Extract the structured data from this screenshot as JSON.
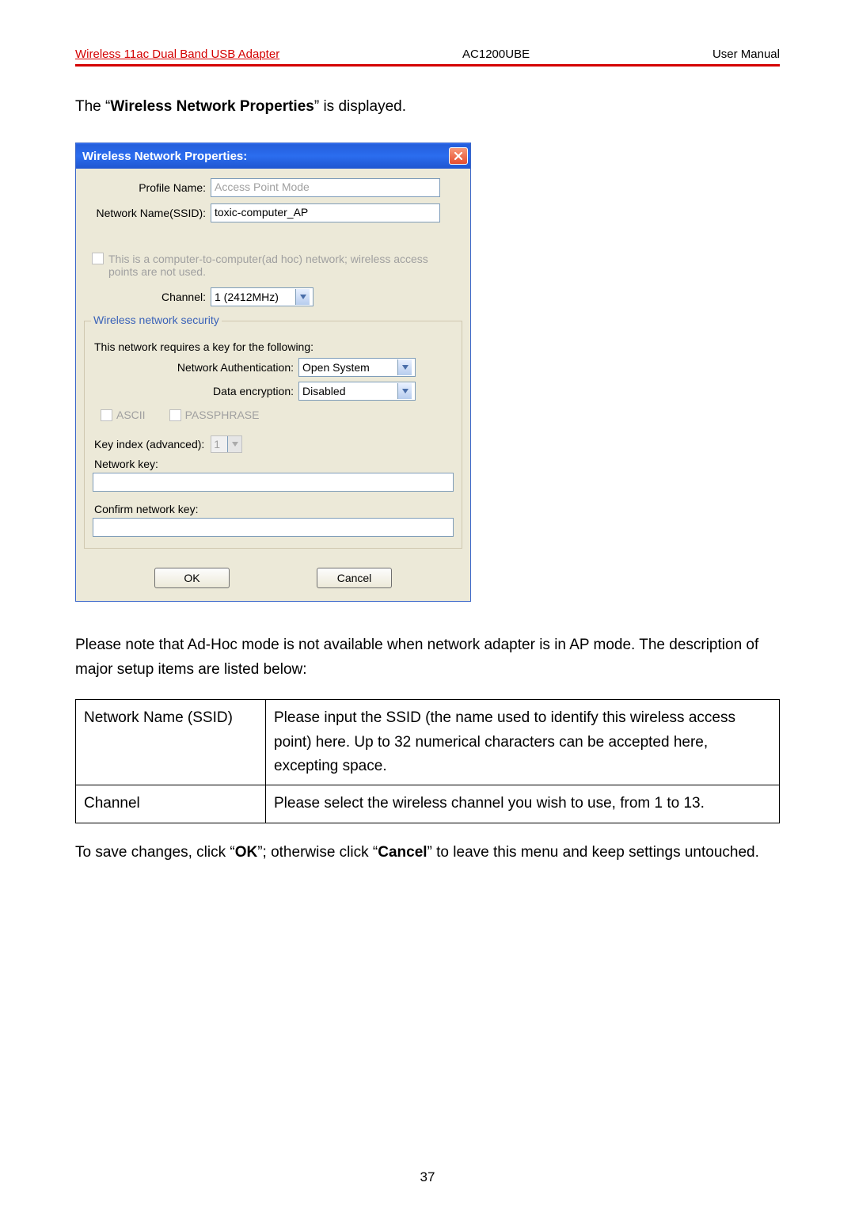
{
  "doc_header": {
    "left": "Wireless 11ac Dual Band USB Adapter",
    "center": "AC1200UBE",
    "right": "User Manual"
  },
  "intro_sentence": {
    "pre": "The “",
    "bold": "Wireless Network Properties",
    "post": "” is displayed."
  },
  "dialog": {
    "title": "Wireless Network Properties:",
    "profile_name_label": "Profile Name:",
    "profile_name_value": "Access Point Mode",
    "ssid_label": "Network Name(SSID):",
    "ssid_value": "toxic-computer_AP",
    "adhoc_text": "This is a computer-to-computer(ad hoc) network; wireless access points are not used.",
    "channel_label": "Channel:",
    "channel_value": "1 (2412MHz)",
    "group_legend": "Wireless network security",
    "group_intro": "This network requires a key for the following:",
    "auth_label": "Network Authentication:",
    "auth_value": "Open System",
    "enc_label": "Data encryption:",
    "enc_value": "Disabled",
    "ascii_label": "ASCII",
    "passphrase_label": "PASSPHRASE",
    "keyidx_label": "Key index (advanced):",
    "keyidx_value": "1",
    "netkey_label": "Network key:",
    "confirmkey_label": "Confirm network key:",
    "ok": "OK",
    "cancel": "Cancel"
  },
  "after_dialog_text": "Please note that Ad-Hoc mode is not available when network adapter is in AP mode. The description of major setup items are listed below:",
  "table": {
    "rows": [
      {
        "c1": "Network Name (SSID)",
        "c2": "Please input the SSID (the name used to identify this wireless access point) here. Up to 32 numerical characters can be accepted here, excepting space."
      },
      {
        "c1": "Channel",
        "c2": "Please select the wireless channel you wish to use, from 1 to 13."
      }
    ]
  },
  "closing_sentence": {
    "p1": "To save changes, click “",
    "b1": "OK",
    "p2": "”; otherwise click “",
    "b2": "Cancel",
    "p3": "” to leave this menu and keep settings untouched."
  },
  "page_number": "37"
}
